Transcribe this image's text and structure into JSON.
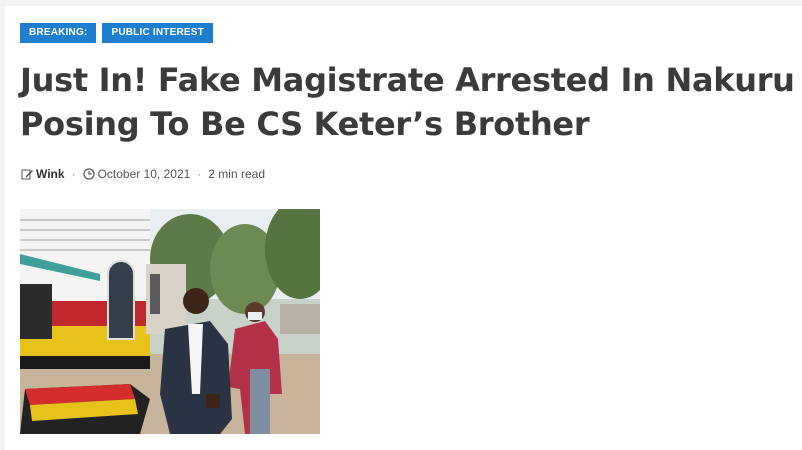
{
  "badges": [
    "BREAKING:",
    "PUBLIC INTEREST"
  ],
  "article": {
    "title": "Just In! Fake Magistrate Arrested In Nakuru Posing To Be CS Keter’s Brother",
    "author": "Wink",
    "date": "October 10, 2021",
    "read_time": "2 min read"
  },
  "icons": {
    "author": "edit-icon",
    "date": "clock-icon"
  },
  "colors": {
    "badge": "#1e7fd0",
    "title": "#3b3b3b"
  }
}
